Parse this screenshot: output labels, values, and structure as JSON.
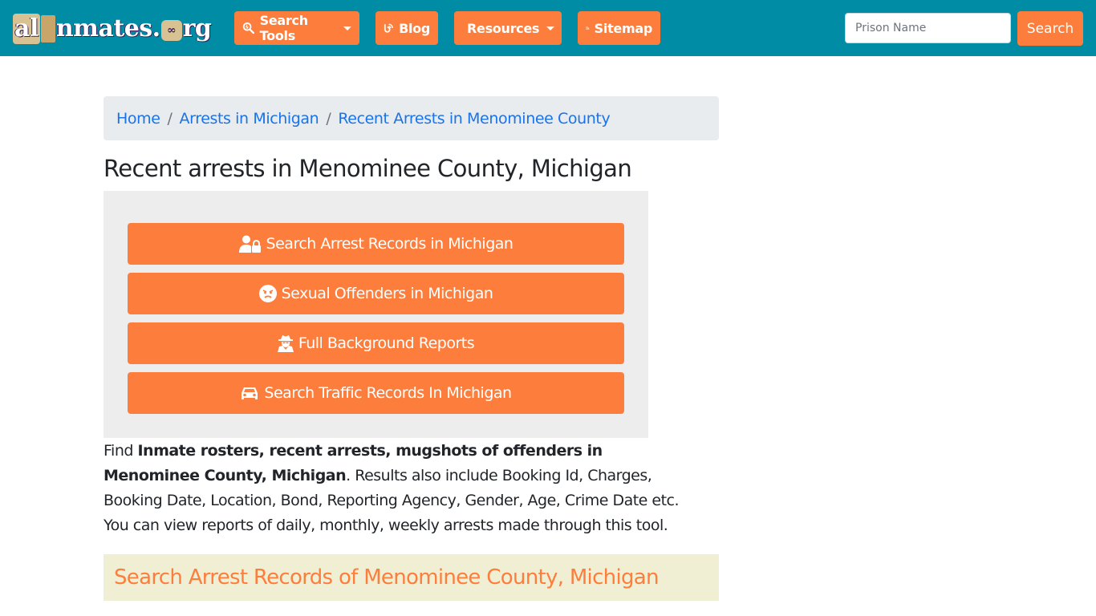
{
  "header": {
    "logo": {
      "part1": "al",
      "part2": "nmates",
      "part3": "rg"
    },
    "nav": [
      {
        "label": "Search Tools",
        "icon": "search-tools-icon",
        "has_dropdown": true
      },
      {
        "label": "Blog",
        "icon": "blog-icon",
        "has_dropdown": false
      },
      {
        "label": "Resources",
        "icon": "leaf-icon",
        "has_dropdown": true
      },
      {
        "label": "Sitemap",
        "icon": "rss-icon",
        "has_dropdown": false
      }
    ],
    "search": {
      "placeholder": "Prison Name",
      "value": "",
      "button_label": "Search"
    }
  },
  "breadcrumb": {
    "items": [
      {
        "label": "Home"
      },
      {
        "label": "Arrests in Michigan"
      },
      {
        "label": "Recent Arrests in Menominee County"
      }
    ],
    "separator": "/"
  },
  "page_title": "Recent arrests in Menominee County, Michigan",
  "action_buttons": [
    {
      "label": "Search Arrest Records in Michigan",
      "icon": "user-lock-icon"
    },
    {
      "label": "Sexual Offenders in Michigan",
      "icon": "angry-face-icon"
    },
    {
      "label": "Full Background Reports",
      "icon": "user-secret-icon"
    },
    {
      "label": "Search Traffic Records In Michigan",
      "icon": "car-icon"
    }
  ],
  "description": {
    "prefix": "Find ",
    "bold": "Inmate rosters, recent arrests, mugshots of offenders in Menominee County, Michigan",
    "suffix": ". Results also include Booking Id, Charges, Booking Date, Location, Bond, Reporting Agency, Gender, Age, Crime Date etc. You can view reports of daily, monthly, weekly arrests made through this tool."
  },
  "section_heading": "Search Arrest Records of Menominee County, Michigan",
  "colors": {
    "header_bg": "#008ca4",
    "accent": "#fd7e3c",
    "link": "#1a73e8",
    "section_bg": "#f0efd4"
  }
}
